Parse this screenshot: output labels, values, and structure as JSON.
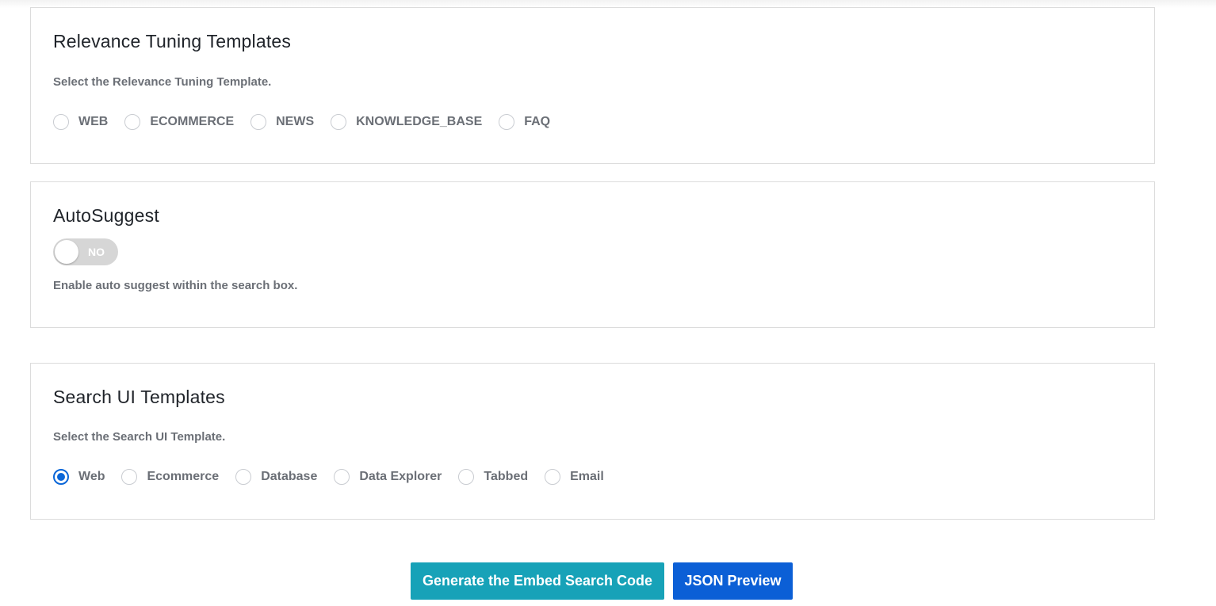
{
  "relevance": {
    "title": "Relevance Tuning Templates",
    "description": "Select the Relevance Tuning Template.",
    "options": [
      "WEB",
      "ECOMMERCE",
      "NEWS",
      "KNOWLEDGE_BASE",
      "FAQ"
    ],
    "selected": null
  },
  "autosuggest": {
    "title": "AutoSuggest",
    "toggle_label": "NO",
    "enabled": false,
    "description": "Enable auto suggest within the search box."
  },
  "search_ui": {
    "title": "Search UI Templates",
    "description": "Select the Search UI Template.",
    "options": [
      "Web",
      "Ecommerce",
      "Database",
      "Data Explorer",
      "Tabbed",
      "Email"
    ],
    "selected": "Web"
  },
  "actions": {
    "generate_label": "Generate the Embed Search Code",
    "json_preview_label": "JSON Preview"
  },
  "colors": {
    "radio_checked": "#0a66d8",
    "generate_button": "#17a2b8",
    "json_button": "#0b5fd6",
    "toggle_off": "#d6d6d6"
  }
}
